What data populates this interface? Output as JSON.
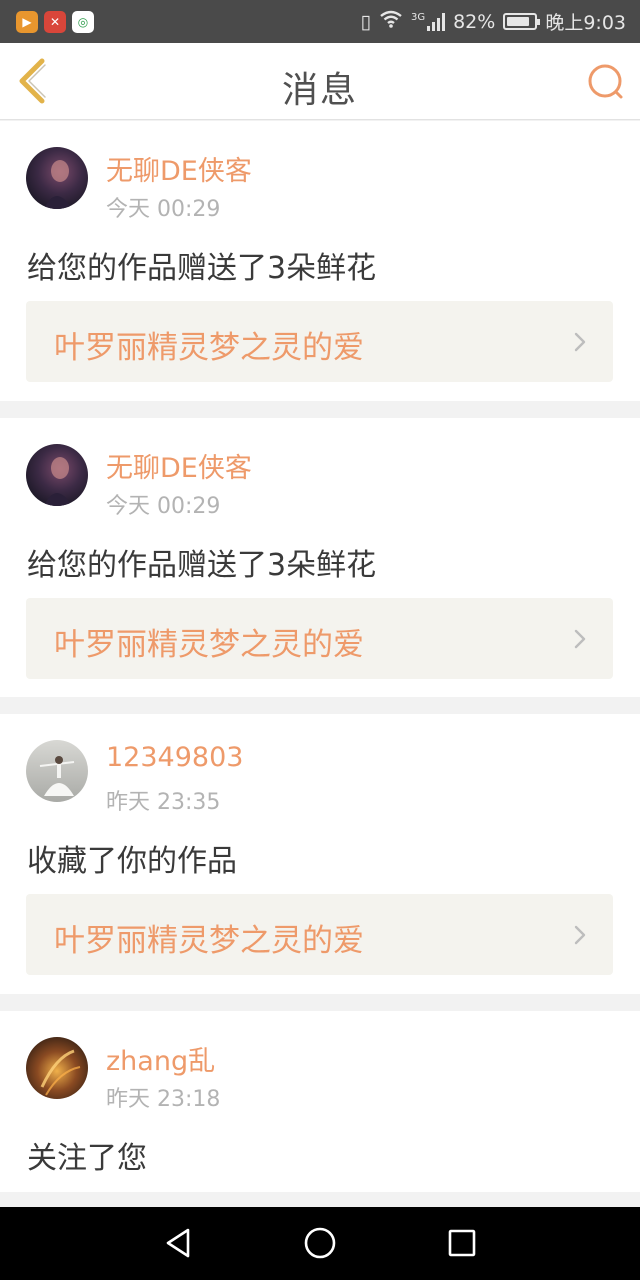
{
  "status_bar": {
    "network": "3G",
    "battery": "82%",
    "time": "晚上9:03"
  },
  "header": {
    "title": "消息"
  },
  "icons": {
    "back": "chevron-left-icon",
    "search": "search-icon",
    "chevron": "chevron-right-icon"
  },
  "colors": {
    "accent": "#ee9a6a",
    "back_arrow": "#e2b34a",
    "link_background": "#f4f3ee"
  },
  "messages": [
    {
      "username": "无聊DE侠客",
      "time": "今天 00:29",
      "action": "给您的作品赠送了3朵鲜花",
      "work_title": "叶罗丽精灵梦之灵的爱"
    },
    {
      "username": "无聊DE侠客",
      "time": "今天 00:29",
      "action": "给您的作品赠送了3朵鲜花",
      "work_title": "叶罗丽精灵梦之灵的爱"
    },
    {
      "username": "12349803",
      "time": "昨天 23:35",
      "action": "收藏了你的作品",
      "work_title": "叶罗丽精灵梦之灵的爱"
    },
    {
      "username": "zhang乱",
      "time": "昨天 23:18",
      "action": "关注了您"
    }
  ]
}
